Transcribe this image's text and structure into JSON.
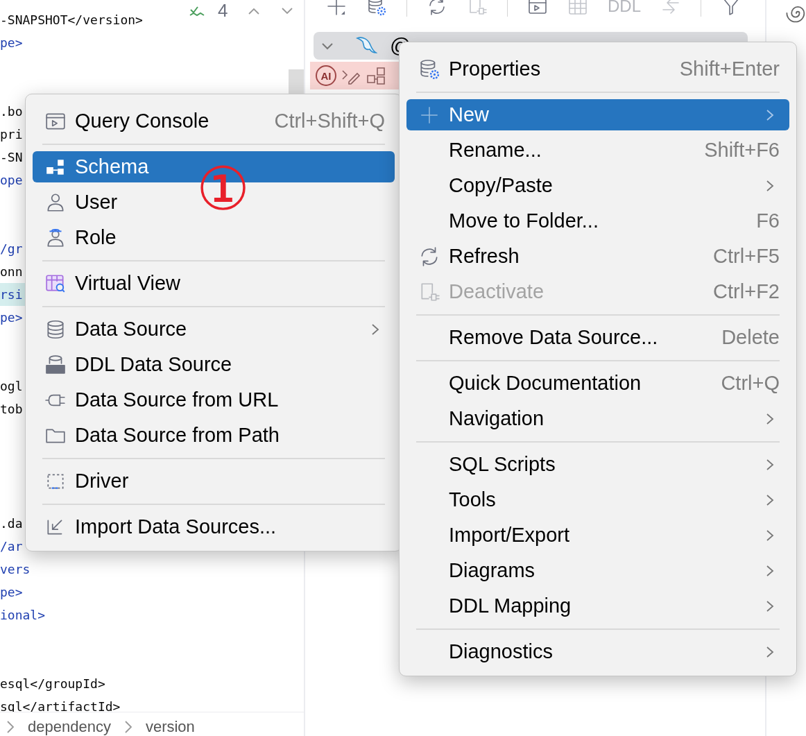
{
  "editor": {
    "inspections": {
      "count": "4"
    },
    "blocks": [
      {
        "lines": [
          {
            "text": "-SNAPSHOT</version>",
            "kind": "text",
            "selected": false
          },
          {
            "text": "pe>",
            "kind": "tag",
            "selected": false
          }
        ]
      },
      {
        "lines": [
          {
            "text": ".bo",
            "kind": "text",
            "selected": false
          },
          {
            "text": "pri",
            "kind": "text",
            "selected": false
          },
          {
            "text": "-SN",
            "kind": "text",
            "selected": false
          },
          {
            "text": "ope",
            "kind": "tag",
            "selected": false
          }
        ]
      },
      {
        "lines": [
          {
            "text": "/gr",
            "kind": "tag",
            "selected": false
          },
          {
            "text": "onn",
            "kind": "text",
            "selected": false
          },
          {
            "text": "rsi",
            "kind": "tag",
            "selected": true
          },
          {
            "text": "pe>",
            "kind": "tag",
            "selected": false
          }
        ]
      },
      {
        "lines": [
          {
            "text": "ogl",
            "kind": "text",
            "selected": false
          },
          {
            "text": "tob",
            "kind": "text",
            "selected": false
          }
        ]
      },
      {
        "lines": [
          {
            "text": ".da",
            "kind": "text",
            "selected": false
          },
          {
            "text": "/ar",
            "kind": "tag",
            "selected": false
          },
          {
            "text": "vers",
            "kind": "tag",
            "selected": false
          },
          {
            "text": "pe>",
            "kind": "tag",
            "selected": false
          },
          {
            "text": "ional>",
            "kind": "tag",
            "selected": false
          }
        ]
      },
      {
        "lines": [
          {
            "text": "esql</groupId>",
            "kind": "text",
            "selected": false
          },
          {
            "text": "sql</artifactId>",
            "kind": "text",
            "selected": false
          }
        ]
      }
    ],
    "breadcrumbs": [
      "dependency",
      "version"
    ]
  },
  "toolbar": {
    "buttons": [
      {
        "disabled": false
      },
      {
        "disabled": false
      },
      {
        "disabled": false
      },
      {
        "disabled": true
      },
      {
        "disabled": false
      },
      {
        "disabled": true
      },
      {
        "label": "DDL",
        "disabled": true
      },
      {
        "disabled": true
      },
      {
        "disabled": false
      }
    ]
  },
  "tree": {
    "node": {
      "label": "@",
      "expanded": true
    },
    "ai_badge": "AI"
  },
  "context_menu": {
    "sections": [
      {
        "items": [
          {
            "label": "Properties",
            "shortcut": "Shift+Enter",
            "submenu": false,
            "selected": false,
            "disabled": false
          }
        ]
      },
      {
        "items": [
          {
            "label": "New",
            "submenu": true,
            "selected": true,
            "disabled": false
          },
          {
            "label": "Rename...",
            "shortcut": "Shift+F6",
            "submenu": false,
            "selected": false,
            "disabled": false
          },
          {
            "label": "Copy/Paste",
            "submenu": true,
            "selected": false,
            "disabled": false
          },
          {
            "label": "Move to Folder...",
            "shortcut": "F6",
            "submenu": false,
            "selected": false,
            "disabled": false
          },
          {
            "label": "Refresh",
            "shortcut": "Ctrl+F5",
            "submenu": false,
            "selected": false,
            "disabled": false
          },
          {
            "label": "Deactivate",
            "shortcut": "Ctrl+F2",
            "submenu": false,
            "selected": false,
            "disabled": true
          }
        ]
      },
      {
        "items": [
          {
            "label": "Remove Data Source...",
            "shortcut": "Delete",
            "submenu": false,
            "selected": false,
            "disabled": false
          }
        ]
      },
      {
        "items": [
          {
            "label": "Quick Documentation",
            "shortcut": "Ctrl+Q",
            "submenu": false,
            "selected": false,
            "disabled": false
          },
          {
            "label": "Navigation",
            "submenu": true,
            "selected": false,
            "disabled": false
          }
        ]
      },
      {
        "items": [
          {
            "label": "SQL Scripts",
            "submenu": true,
            "selected": false,
            "disabled": false
          },
          {
            "label": "Tools",
            "submenu": true,
            "selected": false,
            "disabled": false
          },
          {
            "label": "Import/Export",
            "submenu": true,
            "selected": false,
            "disabled": false
          },
          {
            "label": "Diagrams",
            "submenu": true,
            "selected": false,
            "disabled": false
          },
          {
            "label": "DDL Mapping",
            "submenu": true,
            "selected": false,
            "disabled": false
          }
        ]
      },
      {
        "items": [
          {
            "label": "Diagnostics",
            "submenu": true,
            "selected": false,
            "disabled": false
          }
        ]
      }
    ]
  },
  "new_submenu": {
    "sections": [
      {
        "items": [
          {
            "label": "Query Console",
            "shortcut": "Ctrl+Shift+Q",
            "submenu": false,
            "selected": false,
            "disabled": false
          }
        ]
      },
      {
        "items": [
          {
            "label": "Schema",
            "submenu": false,
            "selected": true,
            "disabled": false
          },
          {
            "label": "User",
            "submenu": false,
            "selected": false,
            "disabled": false
          },
          {
            "label": "Role",
            "submenu": false,
            "selected": false,
            "disabled": false
          }
        ]
      },
      {
        "items": [
          {
            "label": "Virtual View",
            "submenu": false,
            "selected": false,
            "disabled": false
          }
        ]
      },
      {
        "items": [
          {
            "label": "Data Source",
            "submenu": true,
            "selected": false,
            "disabled": false
          },
          {
            "label": "DDL Data Source",
            "submenu": false,
            "selected": false,
            "disabled": false
          },
          {
            "label": "Data Source from URL",
            "submenu": false,
            "selected": false,
            "disabled": false
          },
          {
            "label": "Data Source from Path",
            "submenu": false,
            "selected": false,
            "disabled": false
          }
        ]
      },
      {
        "items": [
          {
            "label": "Driver",
            "submenu": false,
            "selected": false,
            "disabled": false
          }
        ]
      },
      {
        "items": [
          {
            "label": "Import Data Sources...",
            "submenu": false,
            "selected": false,
            "disabled": false
          }
        ]
      }
    ]
  },
  "annotation": {
    "text": "①"
  }
}
